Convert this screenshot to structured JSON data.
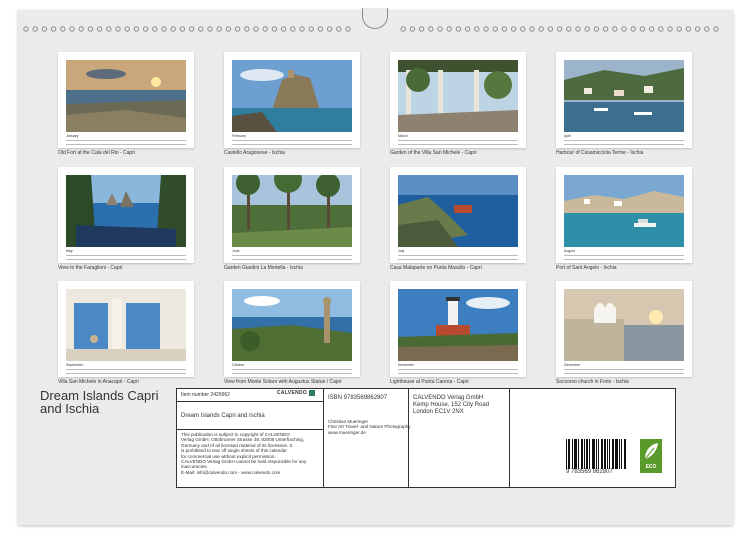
{
  "calendar": {
    "months": [
      {
        "month": "January",
        "caption": "Old Fort at the Cala del Rio - Capri"
      },
      {
        "month": "February",
        "caption": "Castello Aragonese - Ischia"
      },
      {
        "month": "March",
        "caption": "Garden of the Villa San Michele - Capri"
      },
      {
        "month": "April",
        "caption": "Harbour of Casamicciola Terme - Ischia"
      },
      {
        "month": "May",
        "caption": "View to the Faraglioni - Capri"
      },
      {
        "month": "June",
        "caption": "Garden Giardini La Mortella - Ischia"
      },
      {
        "month": "July",
        "caption": "Casa Malaparte on Punta Masullo - Capri"
      },
      {
        "month": "August",
        "caption": "Port of Sant Angelo - Ischia"
      },
      {
        "month": "September",
        "caption": "Villa San Michele in Anacapri - Capri"
      },
      {
        "month": "October",
        "caption": "View from Monte Solaro with Augustus Statue / Capri"
      },
      {
        "month": "November",
        "caption": "Lighthouse at Punta Carena - Capri"
      },
      {
        "month": "December",
        "caption": "Soccorso church in Forio - Ischia"
      }
    ]
  },
  "back": {
    "title_line1": "Dream Islands Capri",
    "title_line2": "and Ischia",
    "item_number": "Item number 2429962",
    "brand": "CALVENDO",
    "product_title": "Dream Islands Capri and Ischia",
    "legal": [
      "This publication is subject to copyright of CALVENDO",
      "Verlag GmbH, Ottobrunner Strasse 38, 82008 Unterhaching,",
      "Germany and of all licensed material of its licensees. It",
      "is prohibited to tear off single sheets of this calendar",
      "for commercial use without explicit permission.",
      "CALVENDO Verlag GmbH cannot be held responsible for any",
      "inaccuracies.",
      "E-Mail: info@calvendo.com - www.calvendo.com"
    ],
    "isbn": "ISBN 9783569862807",
    "publisher": [
      "CALVENDO Verlag GmbH",
      "Kemp House, 152 City Road",
      "London EC1V 2NX"
    ],
    "author": [
      "Christian Mueringer",
      "Fine Art Travel- and Nature Photography",
      "www.mueringer.de"
    ],
    "barcode_digits": "9 783569 862807",
    "eco_label": "ECO"
  },
  "colors": {
    "sheet": "#ebebeb",
    "eco_green": "#5a9a2a",
    "border": "#333333"
  }
}
